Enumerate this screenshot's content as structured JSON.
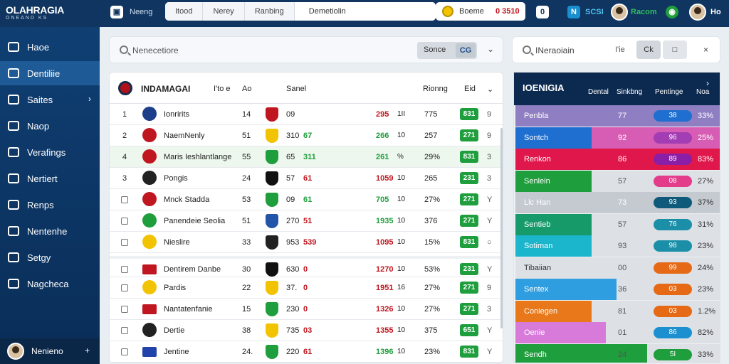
{
  "app": {
    "logo_line1": "OLAHRAGIA",
    "logo_line2": "ONEAND  KS",
    "title_left": "Neeng",
    "title_left_icon": "clipboard-icon"
  },
  "top_tabs": [
    "Itood",
    "Nerey",
    "Ranbing",
    "Demetiolin"
  ],
  "coin": {
    "label": "Boeme",
    "value": "0 3510"
  },
  "top_right": {
    "badge": "0",
    "label_a": "SCSI",
    "label_b": "Racom",
    "label_c": "Ho"
  },
  "sidebar": {
    "items": [
      {
        "label": "Haoe"
      },
      {
        "label": "Dentiliie"
      },
      {
        "label": "Saites"
      },
      {
        "label": "Naop"
      },
      {
        "label": "Verafings"
      },
      {
        "label": "Nertiert"
      },
      {
        "label": "Renps"
      },
      {
        "label": "Nentenhe"
      },
      {
        "label": "Setgy"
      },
      {
        "label": "Nagcheca"
      }
    ],
    "user": "Nenieno"
  },
  "search": {
    "placeholder": "Nenecetiore",
    "seg_a": "Sonce",
    "seg_b": "CG"
  },
  "search2": {
    "placeholder": "INeraoiain",
    "label": "I'ie",
    "btn_a": "Ck",
    "btn_b": "□"
  },
  "table": {
    "title": "INDAMAGAI",
    "headers": [
      "I'to e",
      "Ao",
      "Sanel",
      "Rionng",
      "Eid"
    ],
    "rows": [
      {
        "rank": "1",
        "name": "Ionririts",
        "c1": "14",
        "c2": "09",
        "c3": "",
        "c4": "295",
        "c5": "1II",
        "c6": "775",
        "pill": "831",
        "c8": "9",
        "crest": "#1d3f8a",
        "crest2": "#c0161f",
        "c3color": "#c0161f",
        "c4color": "#c0161f"
      },
      {
        "rank": "2",
        "name": "NaemNenly",
        "c1": "51",
        "c2": "310",
        "c3": "67",
        "c4": "266",
        "c5": "10",
        "c6": "257",
        "pill": "271",
        "c8": "9",
        "crest": "#c0161f",
        "crest2": "#f2c300",
        "c3color": "#1e9e3c",
        "c4color": "#1e9e3c"
      },
      {
        "rank": "4",
        "name": "Maris Ieshlantlange",
        "c1": "55",
        "c2": "65",
        "c3": "311",
        "c4": "261",
        "c5": "%",
        "c6": "29%",
        "pill": "831",
        "c8": "3",
        "crest": "#c0161f",
        "crest2": "#1e9e3c",
        "c3color": "#1e9e3c",
        "c4color": "#1e9e3c"
      },
      {
        "rank": "3",
        "name": "Pongis",
        "c1": "24",
        "c2": "57",
        "c3": "61",
        "c4": "1059",
        "c5": "10",
        "c6": "265",
        "pill": "231",
        "c8": "3",
        "crest": "#222222",
        "crest2": "#111111",
        "c3color": "#c0161f",
        "c4color": "#c0161f"
      },
      {
        "rank": "",
        "name": "Mnck Stadda",
        "c1": "53",
        "c2": "09",
        "c3": "61",
        "c4": "705",
        "c5": "10",
        "c6": "27%",
        "pill": "271",
        "c8": "Y",
        "crest": "#c0161f",
        "crest2": "#1e9e3c",
        "c3color": "#1e9e3c",
        "c4color": "#1e9e3c"
      },
      {
        "rank": "",
        "name": "Panendeie Seolia",
        "c1": "51",
        "c2": "270",
        "c3": "51",
        "c4": "1935",
        "c5": "10",
        "c6": "376",
        "pill": "271",
        "c8": "Y",
        "crest": "#1e9e3c",
        "crest2": "#2255aa",
        "c3color": "#c0161f",
        "c4color": "#1e9e3c"
      },
      {
        "rank": "",
        "name": "Nieslire",
        "c1": "33",
        "c2": "953",
        "c3": "539",
        "c4": "1095",
        "c5": "10",
        "c6": "15%",
        "pill": "831",
        "c8": "○",
        "crest": "#f2c300",
        "crest2": "#222222",
        "c3color": "#c0161f",
        "c4color": "#c0161f"
      },
      {
        "rank": "",
        "name": "Dentirem Danbe",
        "c1": "30",
        "c2": "630",
        "c3": "0",
        "c4": "1270",
        "c5": "10",
        "c6": "53%",
        "pill": "231",
        "c8": "Y",
        "crest": "#c0161f",
        "crest2": "#111111",
        "c3color": "#c0161f",
        "c4color": "#c0161f"
      },
      {
        "rank": "",
        "name": "Pardis",
        "c1": "22",
        "c2": "37.",
        "c3": "0",
        "c4": "1951",
        "c5": "16",
        "c6": "27%",
        "pill": "271",
        "c8": "9",
        "crest": "#f2c300",
        "crest2": "#f2c300",
        "c3color": "#c0161f",
        "c4color": "#c0161f"
      },
      {
        "rank": "",
        "name": "Nantatenfanie",
        "c1": "15",
        "c2": "230",
        "c3": "0",
        "c4": "1326",
        "c5": "10",
        "c6": "27%",
        "pill": "271",
        "c8": "3",
        "crest": "#c0161f",
        "crest2": "#1e9e3c",
        "c3color": "#c0161f",
        "c4color": "#c0161f"
      },
      {
        "rank": "",
        "name": "Dertie",
        "c1": "38",
        "c2": "735",
        "c3": "03",
        "c4": "1355",
        "c5": "10",
        "c6": "375",
        "pill": "651",
        "c8": "Y",
        "crest": "#222222",
        "crest2": "#f2c300",
        "c3color": "#c0161f",
        "c4color": "#c0161f"
      },
      {
        "rank": "",
        "name": "Jentine",
        "c1": "24.",
        "c2": "220",
        "c3": "61",
        "c4": "1396",
        "c5": "10",
        "c6": "23%",
        "pill": "831",
        "c8": "Y",
        "crest": "#2244aa",
        "crest2": "#1e9e3c",
        "c3color": "#c0161f",
        "c4color": "#1e9e3c"
      }
    ]
  },
  "right_panel": {
    "title": "IOENIGIA",
    "headers": [
      "Dental",
      "Sinkbng",
      "Pentinge",
      "Noa"
    ],
    "arrow": "›",
    "rows": [
      {
        "name": "Penbla",
        "v1": "77",
        "badge": "38",
        "pc": "33%",
        "fill": 0.0,
        "fillcolor": "#7c6bb0",
        "badgecolor": "#1e6fcf",
        "bg": "#8f7fc2"
      },
      {
        "name": "Sontch",
        "v1": "92",
        "badge": "96",
        "pc": "25%",
        "fill": 0.37,
        "fillcolor": "#1e6fcf",
        "badgecolor": "#a33db3",
        "bg": "#d75cb3"
      },
      {
        "name": "Renkon",
        "v1": "86",
        "badge": "89",
        "pc": "83%",
        "fill": 1.0,
        "fillcolor": "#e0174a",
        "badgecolor": "#8a1ea6",
        "bg": "#e0174a"
      },
      {
        "name": "Senlein",
        "v1": "57",
        "badge": "08",
        "pc": "27%",
        "fill": 0.37,
        "fillcolor": "#1e9e3c",
        "badgecolor": "#e23c8b",
        "bg": "#dde1e6"
      },
      {
        "name": "Llc Han",
        "v1": "73",
        "badge": "93",
        "pc": "37%",
        "fill": 0.0,
        "fillcolor": "#c8ccd2",
        "badgecolor": "#0f5a7a",
        "bg": "#c5cad1"
      },
      {
        "name": "Sentieb",
        "v1": "57",
        "badge": "76",
        "pc": "31%",
        "fill": 0.37,
        "fillcolor": "#169a6a",
        "badgecolor": "#1b8fa8",
        "bg": "#dde1e6"
      },
      {
        "name": "Sotiman",
        "v1": "93",
        "badge": "98",
        "pc": "23%",
        "fill": 0.37,
        "fillcolor": "#1bb5cc",
        "badgecolor": "#1b8fa8",
        "bg": "#dde1e6"
      },
      {
        "name": "Tibaiian",
        "v1": "00",
        "badge": "99",
        "pc": "24%",
        "fill": 0.0,
        "fillcolor": "#dde1e6",
        "badgecolor": "#e66a16",
        "bg": "#dde1e6"
      },
      {
        "name": "Sentex",
        "v1": "36",
        "badge": "03",
        "pc": "23%",
        "fill": 0.49,
        "fillcolor": "#2f9ee0",
        "badgecolor": "#e66a16",
        "bg": "#dde1e6"
      },
      {
        "name": "Coniegen",
        "v1": "81",
        "badge": "03",
        "pc": "1.2%",
        "fill": 0.37,
        "fillcolor": "#e8781a",
        "badgecolor": "#e66a16",
        "bg": "#dde1e6"
      },
      {
        "name": "Oenie",
        "v1": "01",
        "badge": "86",
        "pc": "82%",
        "fill": 0.44,
        "fillcolor": "#d77ad9",
        "badgecolor": "#1b8fd0",
        "bg": "#dde1e6"
      },
      {
        "name": "Sendh",
        "v1": "24",
        "badge": "5I",
        "pc": "33%",
        "fill": 0.64,
        "fillcolor": "#1e9e3c",
        "badgecolor": "#1e9e3c",
        "bg": "#dde1e6"
      }
    ]
  }
}
